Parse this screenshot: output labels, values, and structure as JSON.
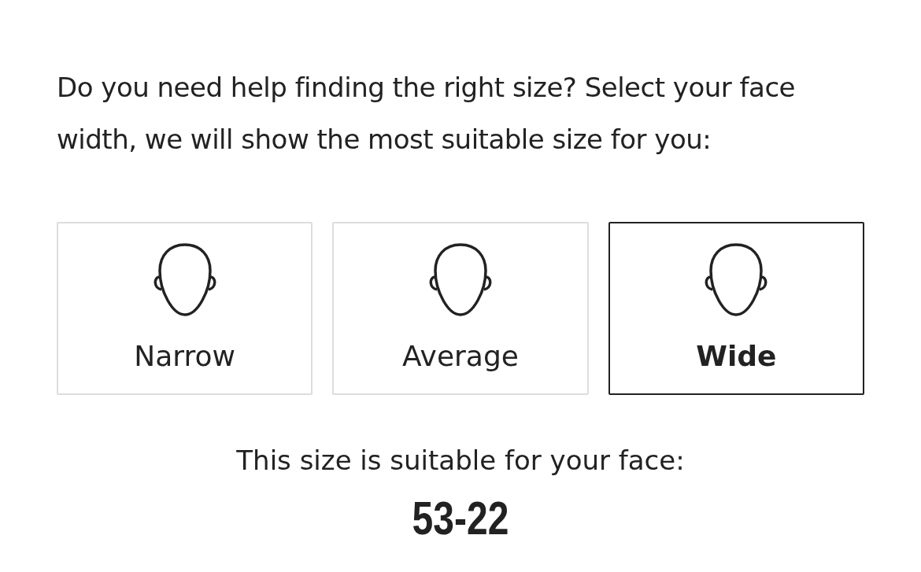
{
  "intro": "Do you need help finding the right size? Select your face width, we will show the most suitable size for you:",
  "options": [
    {
      "label": "Narrow",
      "selected": false
    },
    {
      "label": "Average",
      "selected": false
    },
    {
      "label": "Wide",
      "selected": true
    }
  ],
  "result_label": "This size is suitable for your face:",
  "result_size": "53-22"
}
